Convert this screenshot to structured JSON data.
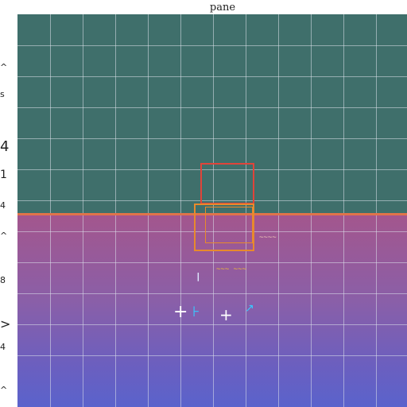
{
  "window": {
    "title": "pane"
  },
  "canvas": {
    "colors": {
      "top_band": "#3f6f6b",
      "bottom_band_start": "#a3568d",
      "bottom_band_end": "#5a63cc",
      "divider": "#e0734a",
      "box_red": "#e0443a",
      "box_orange": "#e88a2c",
      "marker_yellow": "#f0c030",
      "marker_cyan": "#38c8ff"
    }
  },
  "sidebar": {
    "marks": [
      "^",
      "s",
      "4",
      "1",
      "4",
      "^",
      "8",
      ">",
      "4",
      "^"
    ]
  },
  "annotations": {
    "box_label": "~~~~",
    "marker_label": "~~~ ~~~"
  }
}
